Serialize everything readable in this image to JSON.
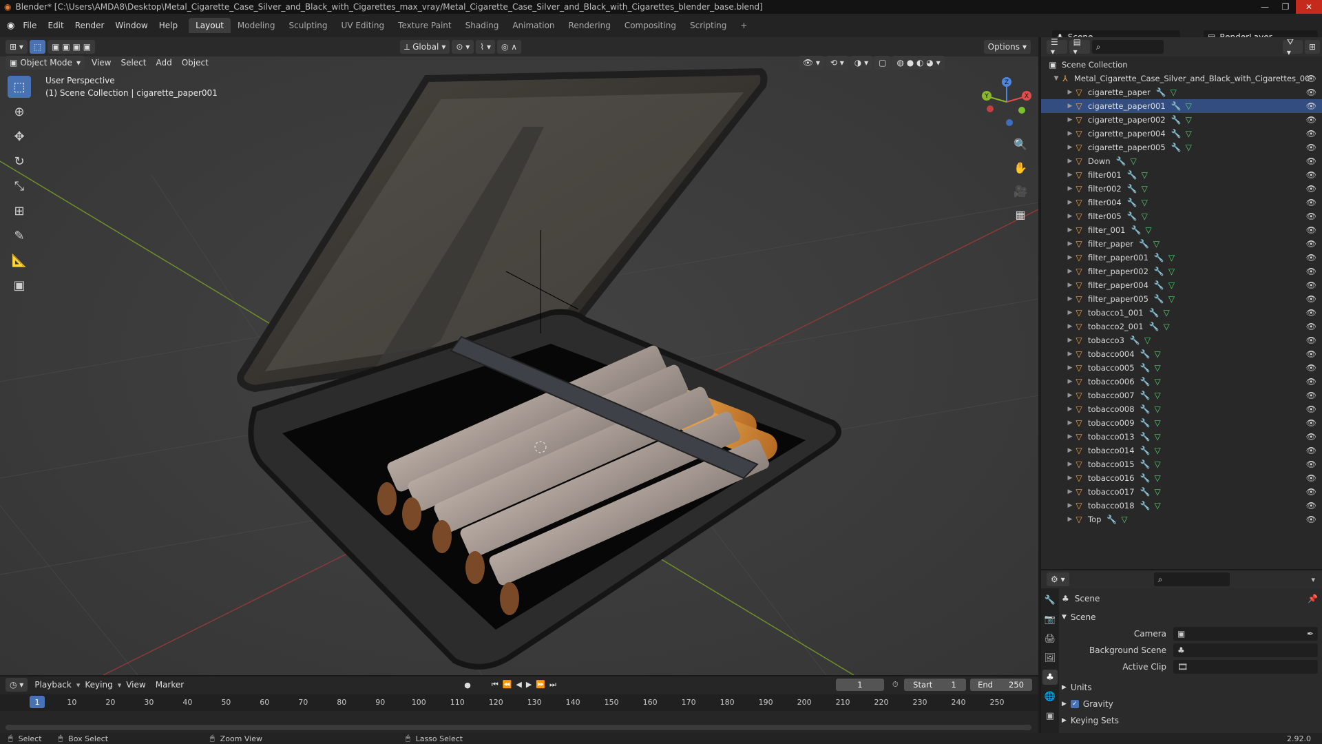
{
  "titlebar": {
    "title": "Blender* [C:\\Users\\AMDA8\\Desktop\\Metal_Cigarette_Case_Silver_and_Black_with_Cigarettes_max_vray/Metal_Cigarette_Case_Silver_and_Black_with_Cigarettes_blender_base.blend]"
  },
  "menu": [
    "File",
    "Edit",
    "Render",
    "Window",
    "Help"
  ],
  "workspaces": [
    "Layout",
    "Modeling",
    "Sculpting",
    "UV Editing",
    "Texture Paint",
    "Shading",
    "Animation",
    "Rendering",
    "Compositing",
    "Scripting"
  ],
  "scene_name": "Scene",
  "render_layer": "RenderLayer",
  "viewport": {
    "transform_orientation": "Global",
    "options_label": "Options",
    "mode": "Object Mode",
    "menus": [
      "View",
      "Select",
      "Add",
      "Object"
    ],
    "perspective_label": "User Perspective",
    "collection_label": "(1) Scene Collection | cigarette_paper001"
  },
  "gizmo": {
    "x": "X",
    "y": "Y",
    "z": "Z"
  },
  "outliner": {
    "root": "Scene Collection",
    "collection": "Metal_Cigarette_Case_Silver_and_Black_with_Cigarettes_00",
    "items": [
      "cigarette_paper",
      "cigarette_paper001",
      "cigarette_paper002",
      "cigarette_paper004",
      "cigarette_paper005",
      "Down",
      "filter001",
      "filter002",
      "filter004",
      "filter005",
      "filter_001",
      "filter_paper",
      "filter_paper001",
      "filter_paper002",
      "filter_paper004",
      "filter_paper005",
      "tobacco1_001",
      "tobacco2_001",
      "tobacco3",
      "tobacco004",
      "tobacco005",
      "tobacco006",
      "tobacco007",
      "tobacco008",
      "tobacco009",
      "tobacco013",
      "tobacco014",
      "tobacco015",
      "tobacco016",
      "tobacco017",
      "tobacco018",
      "Top"
    ]
  },
  "properties": {
    "context": "Scene",
    "panel_title": "Scene",
    "camera_label": "Camera",
    "background_scene_label": "Background Scene",
    "active_clip_label": "Active Clip",
    "units_label": "Units",
    "gravity_label": "Gravity",
    "keying_sets_label": "Keying Sets"
  },
  "timeline": {
    "menus": [
      "Playback",
      "Keying",
      "View",
      "Marker"
    ],
    "current_frame": "1",
    "start_label": "Start",
    "start": "1",
    "end_label": "End",
    "end": "250",
    "ticks": [
      "1",
      "10",
      "20",
      "30",
      "40",
      "50",
      "60",
      "70",
      "80",
      "90",
      "100",
      "110",
      "120",
      "130",
      "140",
      "150",
      "160",
      "170",
      "180",
      "190",
      "200",
      "210",
      "220",
      "230",
      "240",
      "250"
    ]
  },
  "statusbar": {
    "select": "Select",
    "box_select": "Box Select",
    "zoom_view": "Zoom View",
    "lasso_select": "Lasso Select",
    "version": "2.92.0"
  }
}
